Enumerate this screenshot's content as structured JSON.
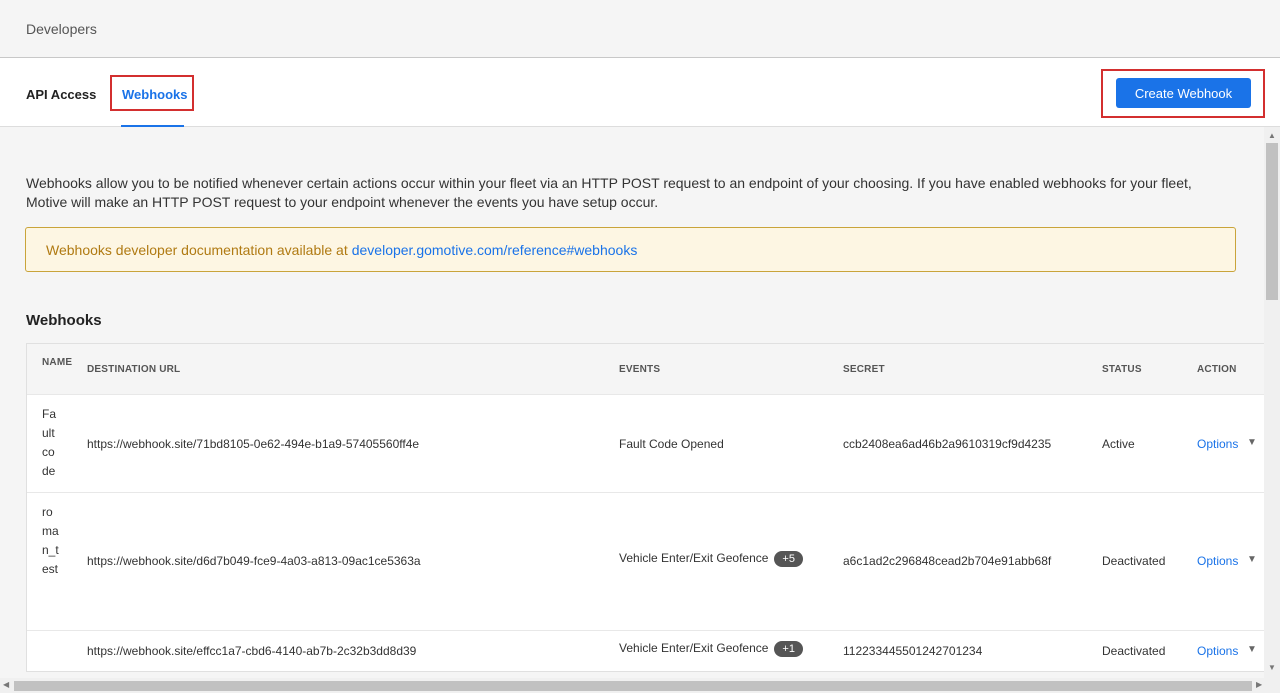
{
  "header": {
    "title": "Developers"
  },
  "tabs": [
    {
      "label": "API Access",
      "active": false
    },
    {
      "label": "Webhooks",
      "active": true
    }
  ],
  "create_button": "Create Webhook",
  "intro": "Webhooks allow you to be notified whenever certain actions occur within your fleet via an HTTP POST request to an endpoint of your choosing. If you have enabled webhooks for your fleet, Motive will make an HTTP POST request to your endpoint whenever the events you have setup occur.",
  "notice": {
    "text": "Webhooks developer documentation available at",
    "link": "developer.gomotive.com/reference#webhooks"
  },
  "section_title": "Webhooks",
  "table": {
    "headers": {
      "name": "NAME",
      "url": "DESTINATION URL",
      "events": "EVENTS",
      "secret": "SECRET",
      "status": "STATUS",
      "action": "ACTION"
    },
    "rows": [
      {
        "name": "Fault code",
        "url": "https://webhook.site/71bd8105-0e62-494e-b1a9-57405560ff4e",
        "events": "Fault Code Opened",
        "extra": "",
        "secret": "ccb2408ea6ad46b2a9610319cf9d4235",
        "status": "Active",
        "action": "Options"
      },
      {
        "name": "roman_test",
        "url": "https://webhook.site/d6d7b049-fce9-4a03-a813-09ac1ce5363a",
        "events": "Vehicle Enter/Exit Geofence",
        "extra": "+5",
        "secret": "a6c1ad2c296848cead2b704e91abb68f",
        "status": "Deactivated",
        "action": "Options"
      },
      {
        "name": "",
        "url": "https://webhook.site/effcc1a7-cbd6-4140-ab7b-2c32b3dd8d39",
        "events": "Vehicle Enter/Exit Geofence",
        "extra": "+1",
        "secret": "112233445501242701234",
        "status": "Deactivated",
        "action": "Options"
      }
    ]
  },
  "colors": {
    "accent": "#1a73e8",
    "highlight": "#d32f2f",
    "notice_bg": "#fdf6e3",
    "notice_text": "#b07a12"
  }
}
